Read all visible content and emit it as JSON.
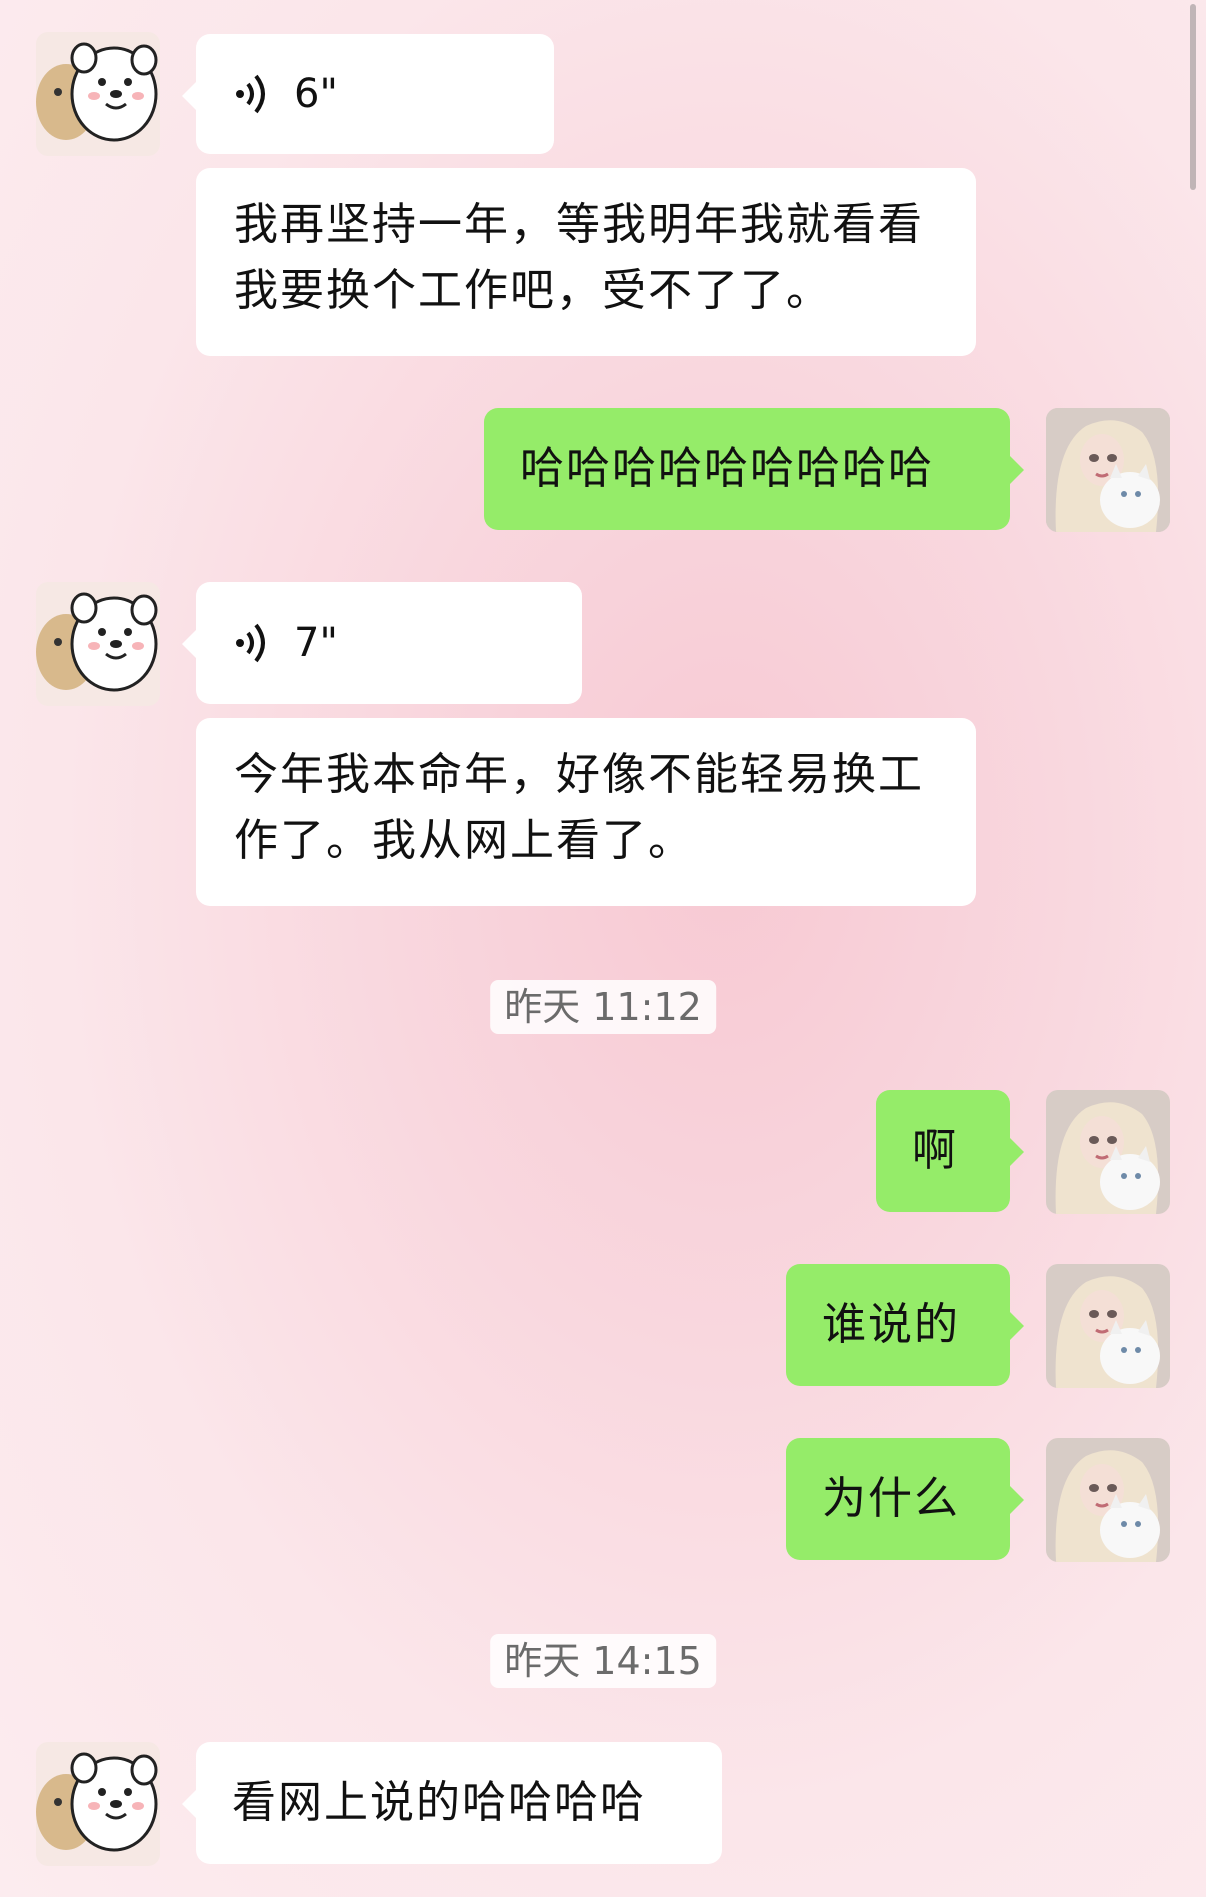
{
  "chat": {
    "messages": [
      {
        "side": "left",
        "type": "voice",
        "duration": "6\""
      },
      {
        "side": "left",
        "type": "text",
        "text": "我再坚持一年，等我明年我就看看我要换个工作吧，受不了了。"
      },
      {
        "side": "right",
        "type": "text",
        "text": "哈哈哈哈哈哈哈哈哈"
      },
      {
        "side": "left",
        "type": "voice",
        "duration": "7\""
      },
      {
        "side": "left",
        "type": "text",
        "text": "今年我本命年，好像不能轻易换工作了。我从网上看了。"
      },
      {
        "type": "timestamp",
        "text": "昨天 11:12"
      },
      {
        "side": "right",
        "type": "text",
        "text": "啊"
      },
      {
        "side": "right",
        "type": "text",
        "text": "谁说的"
      },
      {
        "side": "right",
        "type": "text",
        "text": "为什么"
      },
      {
        "type": "timestamp",
        "text": "昨天 14:15"
      },
      {
        "side": "left",
        "type": "text",
        "text": "看网上说的哈哈哈哈"
      }
    ]
  },
  "avatars": {
    "left": {
      "icon": "bear-dog-cartoon-avatar"
    },
    "right": {
      "icon": "girl-with-cat-avatar"
    }
  },
  "colors": {
    "outgoing_bubble": "#95ec69",
    "incoming_bubble": "#ffffff",
    "timestamp_text": "#6b6b6b"
  }
}
